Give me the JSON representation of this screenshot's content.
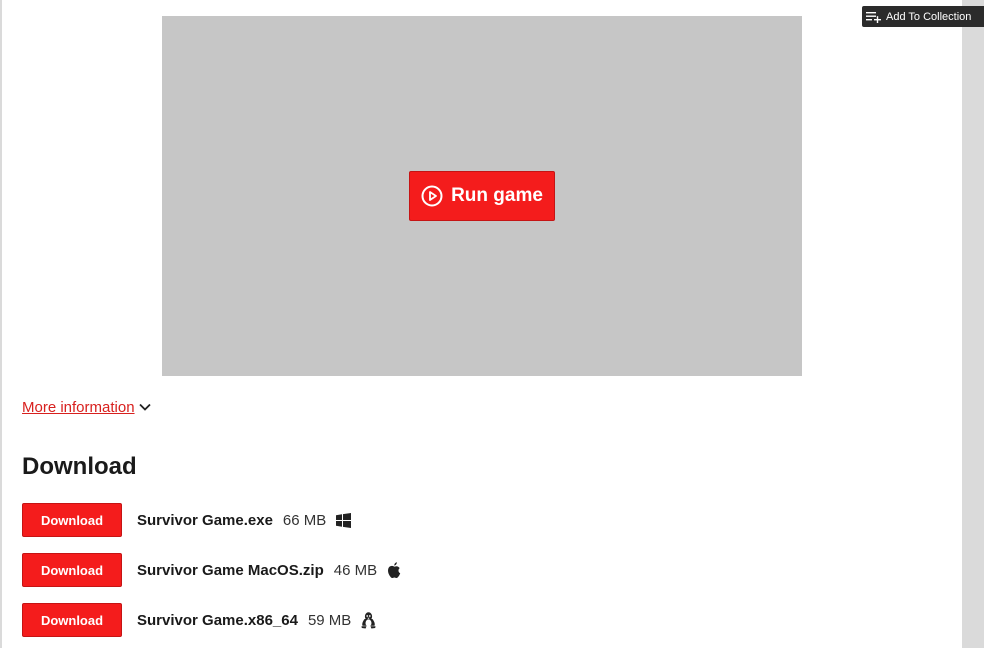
{
  "header": {
    "add_to_collection_label": "Add To Collection"
  },
  "game": {
    "run_label": "Run game"
  },
  "more_info": {
    "label": "More information"
  },
  "downloads": {
    "heading": "Download",
    "items": [
      {
        "button_label": "Download",
        "file_name": "Survivor Game.exe",
        "size": "66 MB",
        "os_icon": "windows-icon"
      },
      {
        "button_label": "Download",
        "file_name": "Survivor Game MacOS.zip",
        "size": "46 MB",
        "os_icon": "apple-icon"
      },
      {
        "button_label": "Download",
        "file_name": "Survivor Game.x86_64",
        "size": "59 MB",
        "os_icon": "linux-icon"
      }
    ]
  },
  "colors": {
    "accent_red": "#f41c1c",
    "link_red": "#d8201e",
    "frame_gray": "#c6c6c6",
    "dark_button": "#2b2b2b"
  }
}
